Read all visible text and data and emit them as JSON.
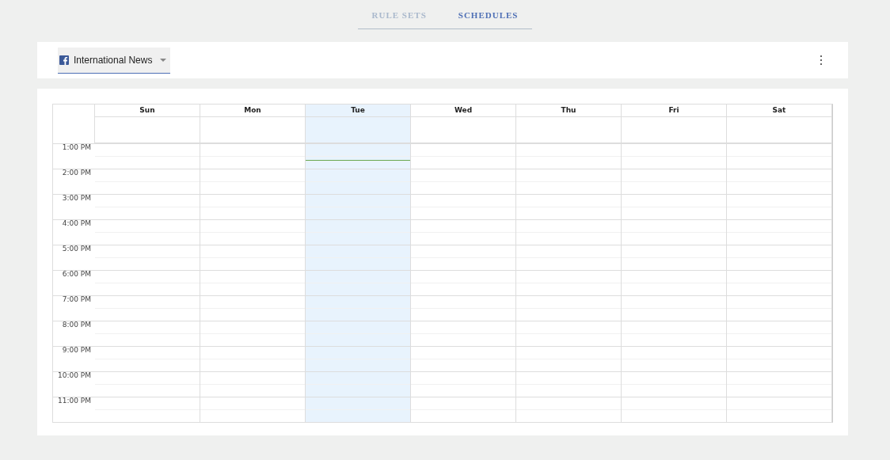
{
  "tabs": [
    {
      "label": "RULE SETS",
      "selected": false
    },
    {
      "label": "SCHEDULES",
      "selected": true
    }
  ],
  "toolbar": {
    "account": {
      "label": "International News"
    }
  },
  "calendar": {
    "days": [
      {
        "label": "Sun",
        "today": false
      },
      {
        "label": "Mon",
        "today": false
      },
      {
        "label": "Tue",
        "today": true
      },
      {
        "label": "Wed",
        "today": false
      },
      {
        "label": "Thu",
        "today": false
      },
      {
        "label": "Fri",
        "today": false
      },
      {
        "label": "Sat",
        "today": false
      }
    ],
    "hours": [
      "1:00 PM",
      "2:00 PM",
      "3:00 PM",
      "4:00 PM",
      "5:00 PM",
      "6:00 PM",
      "7:00 PM",
      "8:00 PM",
      "9:00 PM",
      "10:00 PM",
      "11:00 PM"
    ]
  }
}
